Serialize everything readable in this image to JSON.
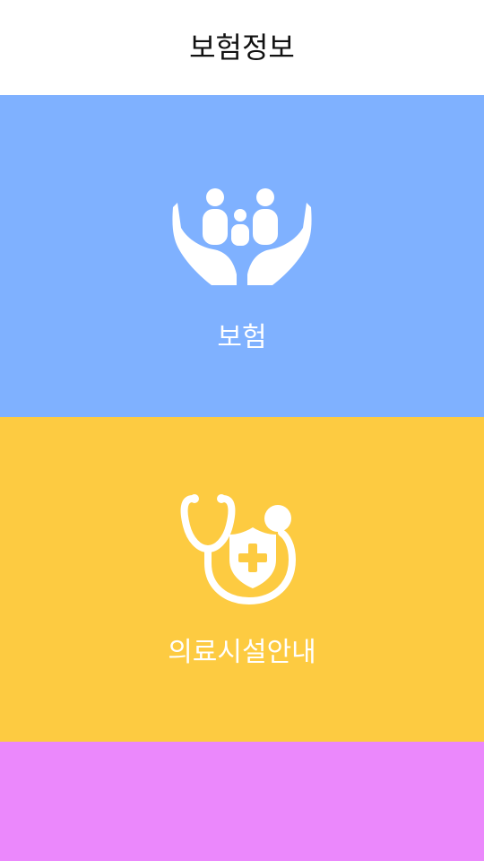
{
  "header": {
    "title": "보험정보"
  },
  "tiles": [
    {
      "label": "보험",
      "icon": "family-care-hands-icon",
      "color": "#7fb1ff"
    },
    {
      "label": "의료시설안내",
      "icon": "stethoscope-shield-icon",
      "color": "#fdcb41"
    },
    {
      "label": "",
      "icon": "",
      "color": "#eb88fc"
    }
  ]
}
